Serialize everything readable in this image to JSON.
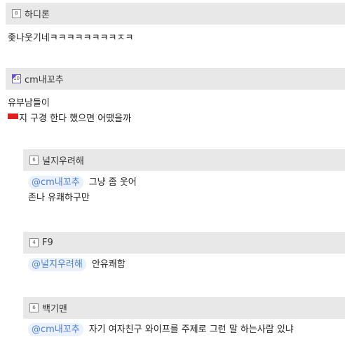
{
  "comments": [
    {
      "level": "8",
      "author": "하디론",
      "lines": [
        "좇나웃기네ㅋㅋㅋㅋㅋㅋㅋㅋㅈㅋ"
      ]
    },
    {
      "level": "10",
      "author": "cm내꼬추",
      "lines": [
        "유부남들이",
        "지 구경 한다 했으면 어땠을까"
      ]
    },
    {
      "level": "6",
      "author": "널지우려해",
      "mention": "@cm내꼬추",
      "lines": [
        "그냥 좀 웃어",
        "존나 유쾌하구만"
      ]
    },
    {
      "level": "4",
      "author": "F9",
      "mention": "@널지우려해",
      "lines": [
        "안유쾌함"
      ]
    },
    {
      "level": "6",
      "author": "백기맨",
      "mention": "@cm내꼬추",
      "lines": [
        "자기 여자친구 와이프를 주제로 그런 말 하는사람 있냐"
      ]
    }
  ],
  "colors": {
    "header_bg": "#e8e8e8",
    "mention_text": "#4a7fc9",
    "mention_bg": "#eaf1fb",
    "level_purple": "#6b55c9",
    "emoticon_red": "#e02020"
  },
  "icons": {
    "level_badge": "level-badge-icon",
    "inline_emoticon": "red-emoticon-icon"
  }
}
